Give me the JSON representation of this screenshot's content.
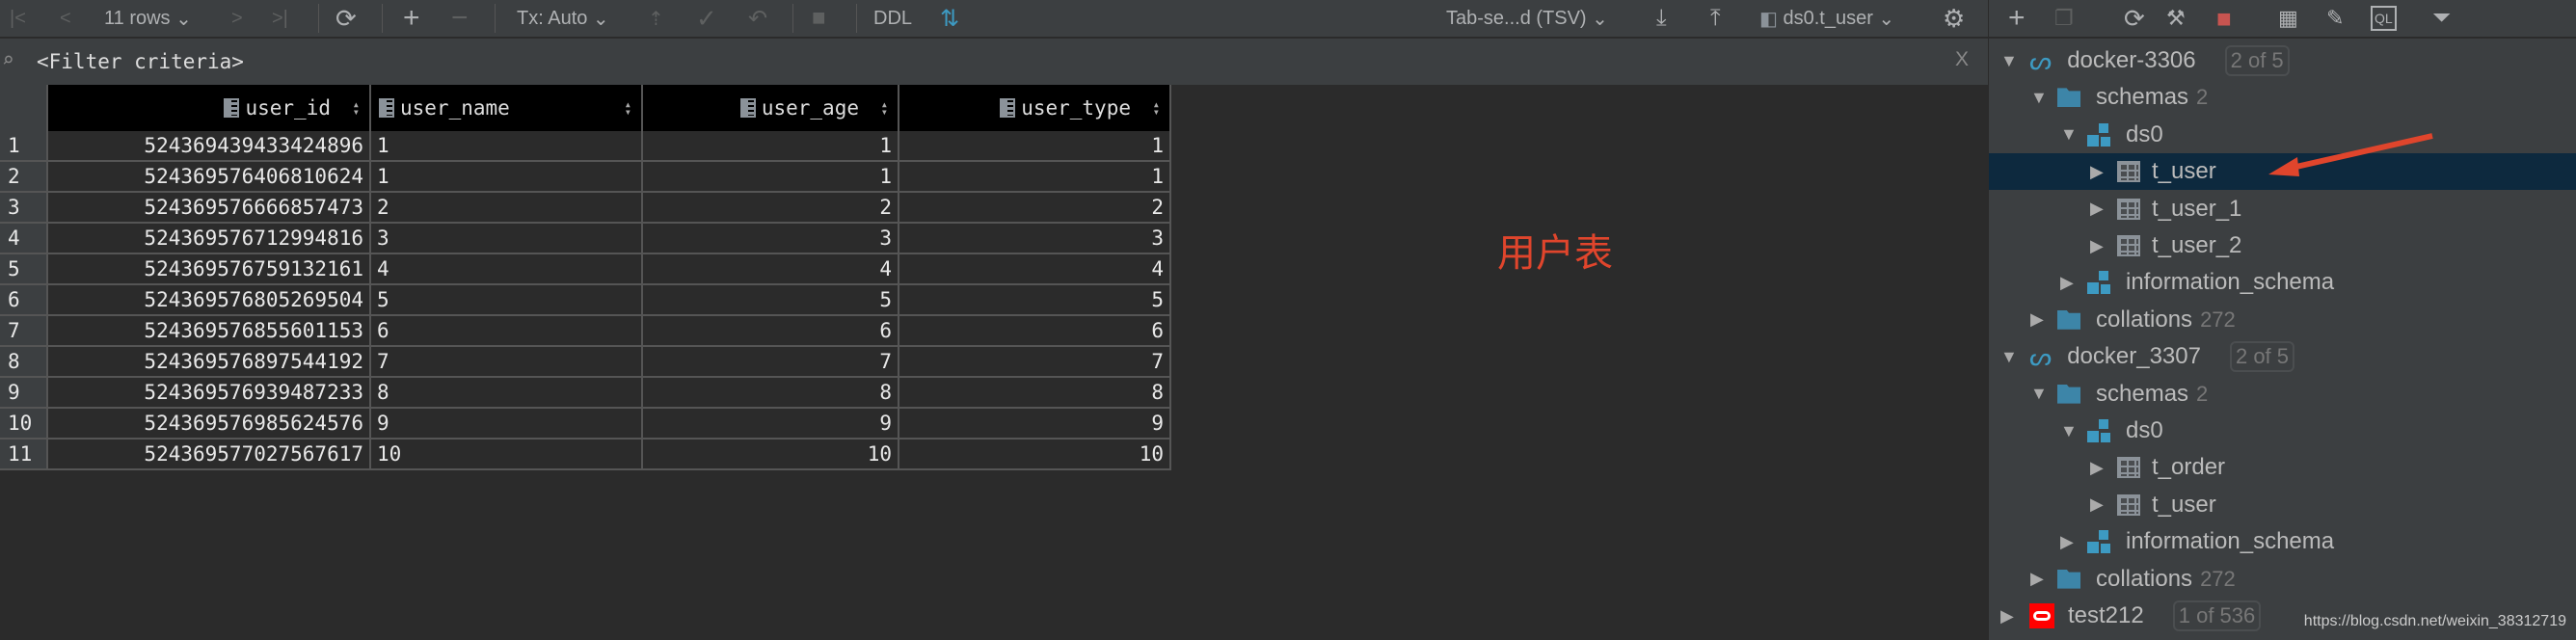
{
  "toolbar": {
    "rows": "11 rows",
    "tx": "Tx: Auto",
    "ddl": "DDL",
    "format": "Tab-se...d (TSV)",
    "target": "ds0.t_user"
  },
  "filter": {
    "placeholder": "<Filter criteria>",
    "close": "X"
  },
  "table": {
    "columns": [
      "user_id",
      "user_name",
      "user_age",
      "user_type"
    ],
    "rows": [
      [
        "1",
        "524369439433424896",
        "1",
        "1",
        "1"
      ],
      [
        "2",
        "524369576406810624",
        "1",
        "1",
        "1"
      ],
      [
        "3",
        "524369576666857473",
        "2",
        "2",
        "2"
      ],
      [
        "4",
        "524369576712994816",
        "3",
        "3",
        "3"
      ],
      [
        "5",
        "524369576759132161",
        "4",
        "4",
        "4"
      ],
      [
        "6",
        "524369576805269504",
        "5",
        "5",
        "5"
      ],
      [
        "7",
        "524369576855601153",
        "6",
        "6",
        "6"
      ],
      [
        "8",
        "524369576897544192",
        "7",
        "7",
        "7"
      ],
      [
        "9",
        "524369576939487233",
        "8",
        "8",
        "8"
      ],
      [
        "10",
        "524369576985624576",
        "9",
        "9",
        "9"
      ],
      [
        "11",
        "524369577027567617",
        "10",
        "10",
        "10"
      ]
    ]
  },
  "annotation": "用户表",
  "tree": {
    "nodes": [
      {
        "label": "docker-3306",
        "badge": "2 of 5"
      },
      {
        "label": "schemas",
        "count": "2"
      },
      {
        "label": "ds0"
      },
      {
        "label": "t_user"
      },
      {
        "label": "t_user_1"
      },
      {
        "label": "t_user_2"
      },
      {
        "label": "information_schema"
      },
      {
        "label": "collations",
        "count": "272"
      },
      {
        "label": "docker_3307",
        "badge": "2 of 5"
      },
      {
        "label": "schemas",
        "count": "2"
      },
      {
        "label": "ds0"
      },
      {
        "label": "t_order"
      },
      {
        "label": "t_user"
      },
      {
        "label": "information_schema"
      },
      {
        "label": "collations",
        "count": "272"
      },
      {
        "label": "test212",
        "badge": "1 of 536"
      }
    ]
  },
  "watermark": "https://blog.csdn.net/weixin_38312719",
  "colors": {
    "accent": "#3d9ac2",
    "annotation": "#e0452c",
    "selection": "#0d293e"
  }
}
